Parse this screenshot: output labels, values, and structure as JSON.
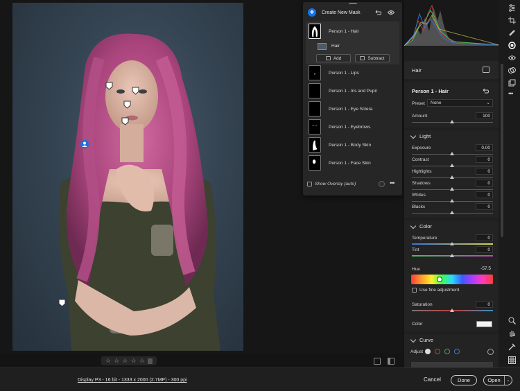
{
  "masks": {
    "create_label": "Create New Mask",
    "group": {
      "name": "Person 1 - Hair",
      "sub_name": "Hair",
      "add_label": "Add",
      "subtract_label": "Subtract"
    },
    "items": [
      "Person 1 - Lips",
      "Person 1 - Iris and Pupil",
      "Person 1 - Eye Sclera",
      "Person 1 - Eyebrows",
      "Person 1 - Body Skin",
      "Person 1 - Face Skin"
    ],
    "overlay_label": "Show Overlay (auto)"
  },
  "edit": {
    "section_title": "Hair",
    "mask_name": "Person 1 - Hair",
    "preset_label": "Preset",
    "preset_value": "None",
    "amount_label": "Amount",
    "amount_value": "100",
    "light_title": "Light",
    "light": [
      {
        "label": "Exposure",
        "value": "0.00"
      },
      {
        "label": "Contrast",
        "value": "0"
      },
      {
        "label": "Highlights",
        "value": "0"
      },
      {
        "label": "Shadows",
        "value": "0"
      },
      {
        "label": "Whites",
        "value": "0"
      },
      {
        "label": "Blacks",
        "value": "0"
      }
    ],
    "color_title": "Color",
    "temperature_label": "Temperature",
    "temperature_value": "0",
    "tint_label": "Tint",
    "tint_value": "0",
    "hue_label": "Hue",
    "hue_value": "-57.5",
    "fine_adjust_label": "Use fine adjustment",
    "saturation_label": "Saturation",
    "saturation_value": "0",
    "color_label": "Color",
    "curve_title": "Curve",
    "adjust_label": "Adjust"
  },
  "rating": {
    "stars": [
      "☆",
      "☆",
      "☆",
      "☆",
      "☆"
    ]
  },
  "footer": {
    "file_info": "Display P3 - 16 bit - 1333 x 2000 (2.7MP) - 300 ppi",
    "cancel": "Cancel",
    "done": "Done",
    "open": "Open"
  },
  "colors": {
    "accent": "#1473e6",
    "hair": "#b0487e"
  }
}
